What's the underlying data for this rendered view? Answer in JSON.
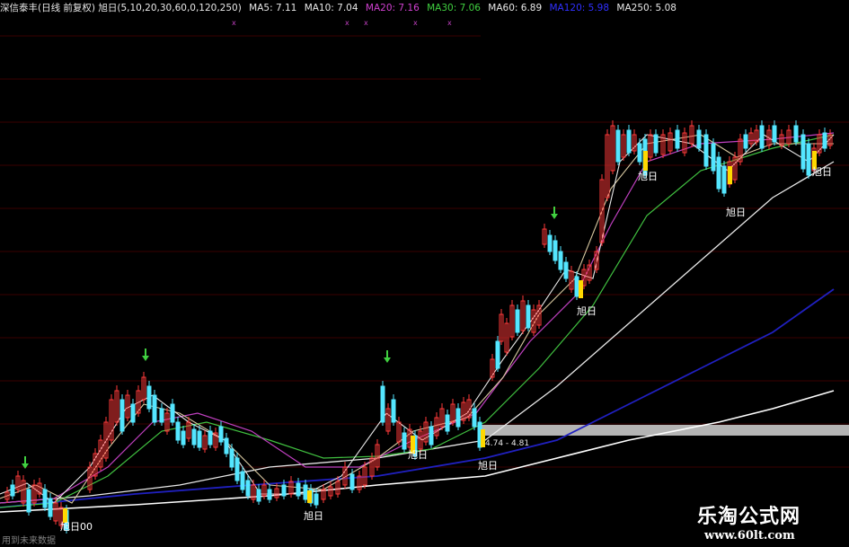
{
  "header": {
    "title": "深信泰丰(日线 前复权) 旭日(5,10,20,30,60,0,120,250)",
    "ma": [
      {
        "label": "MA5: 7.11",
        "color": "#e8e8e8"
      },
      {
        "label": "MA10: 7.04",
        "color": "#e8e8e8"
      },
      {
        "label": "MA20: 7.16",
        "color": "#d040d0"
      },
      {
        "label": "MA30: 7.06",
        "color": "#40d040"
      },
      {
        "label": "MA60: 6.89",
        "color": "#e8e8e8"
      },
      {
        "label": "MA120: 5.98",
        "color": "#3030ff"
      },
      {
        "label": "MA250: 5.08",
        "color": "#e8e8e8"
      }
    ],
    "title_color": "#e8e8e8"
  },
  "signals": {
    "label": "旭日",
    "first_label": "旭日00"
  },
  "price_box": {
    "text": "4.74 - 4.81"
  },
  "bottom_text": "用到未来数据",
  "watermark": {
    "name": "乐淘公式网",
    "url": "www.60lt.com"
  },
  "colors": {
    "up": "#ff3a3a",
    "down": "#54e6ff",
    "signal_bar": "#ffd800",
    "arrow": "#40d040",
    "ma5": "#e8e8e8",
    "ma10": "#d8c8a0",
    "ma20": "#c040c0",
    "ma30": "#40c040",
    "ma60": "#e8e8e8",
    "ma120": "#2020c0",
    "ma250": "#ffffff"
  }
}
